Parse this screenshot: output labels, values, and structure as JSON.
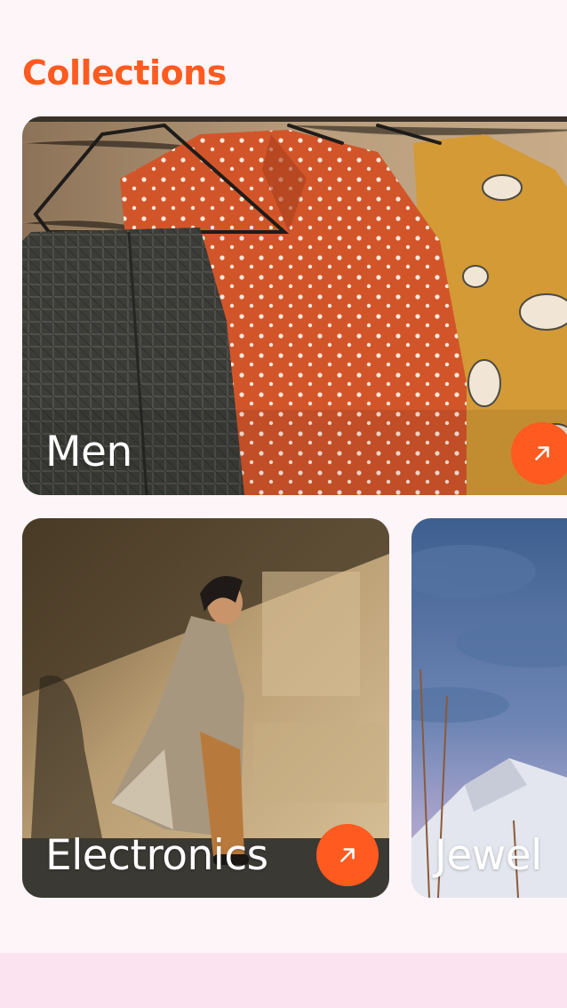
{
  "header": {
    "title": "Collections"
  },
  "collections": [
    {
      "label": "Men",
      "image": "clothes-on-hangers-photo"
    },
    {
      "label": "Electronics",
      "image": "person-walking-coat-photo"
    },
    {
      "label": "Jewel",
      "image": "cloudy-sky-tent-photo"
    }
  ],
  "colors": {
    "accent": "#ff5a1f",
    "background": "#fdf5f8",
    "bottom_bar": "#fbe4ef",
    "label_text": "#ffffff"
  },
  "icons": {
    "open": "arrow-up-right-icon"
  }
}
